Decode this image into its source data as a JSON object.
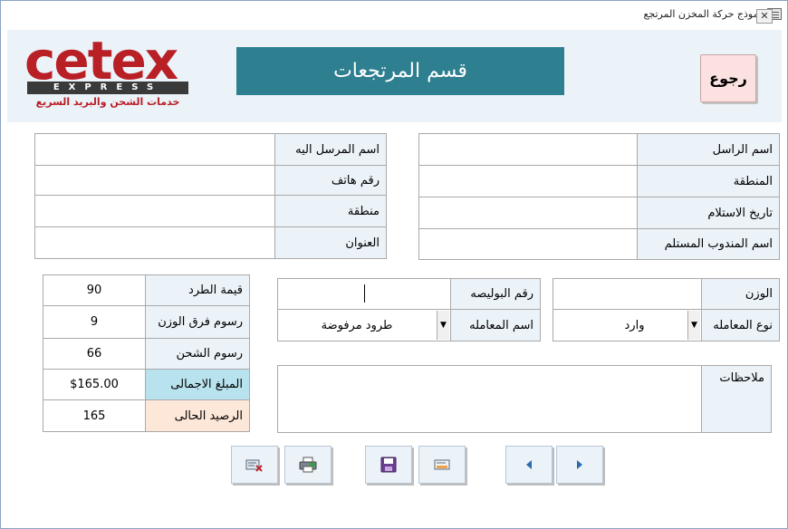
{
  "window": {
    "title": "نموذج حركة المخزن المرتجع",
    "close_glyph": "✕"
  },
  "logo": {
    "name": "cetex",
    "sub": "EXPRESS",
    "tagline": "خدمات الشحن والبريد السريع"
  },
  "header": {
    "title": "قسم المرتجعات",
    "back_label": "رجوع"
  },
  "sender": {
    "name_label": "اسم الراسل",
    "name_value": "",
    "region_label": "المنطقة",
    "region_value": "",
    "receipt_date_label": "تاريخ الاستلام",
    "receipt_date_value": "",
    "delegate_label": "اسم المندوب المستلم",
    "delegate_value": ""
  },
  "recipient": {
    "name_label": "اسم المرسل اليه",
    "name_value": "",
    "phone_label": "رقم هاتف",
    "phone_value": "",
    "region_label": "منطقة",
    "region_value": "",
    "address_label": "العنوان",
    "address_value": ""
  },
  "shipment": {
    "weight_label": "الوزن",
    "weight_value": "",
    "transaction_type_label": "نوع المعامله",
    "transaction_type_value": "وارد",
    "policy_number_label": "رقم البوليصه",
    "policy_number_value": "",
    "transaction_name_label": "اسم المعامله",
    "transaction_name_value": "طرود مرفوضة",
    "notes_label": "ملاحظات",
    "notes_value": ""
  },
  "costs": {
    "parcel_value_label": "قيمة الطرد",
    "parcel_value": "90",
    "weight_diff_label": "رسوم فرق الوزن",
    "weight_diff_value": "9",
    "shipping_fee_label": "رسوم الشحن",
    "shipping_fee_value": "66",
    "total_label": "المبلغ الاجمالى",
    "total_value": "$165.00",
    "balance_label": "الرصيد الحالى",
    "balance_value": "165"
  },
  "toolbar": {
    "icons": [
      "delete-record-icon",
      "print-icon",
      "save-icon",
      "new-record-icon",
      "previous-record-icon",
      "next-record-icon"
    ]
  },
  "colors": {
    "banner": "#2e7f90",
    "label_bg": "#ebf2f8",
    "total_label_bg": "#b8e3ee",
    "balance_label_bg": "#fde7d9",
    "back_button_bg": "#fbe1df",
    "logo_red": "#b82026",
    "nav_arrow": "#2a6cb0"
  }
}
